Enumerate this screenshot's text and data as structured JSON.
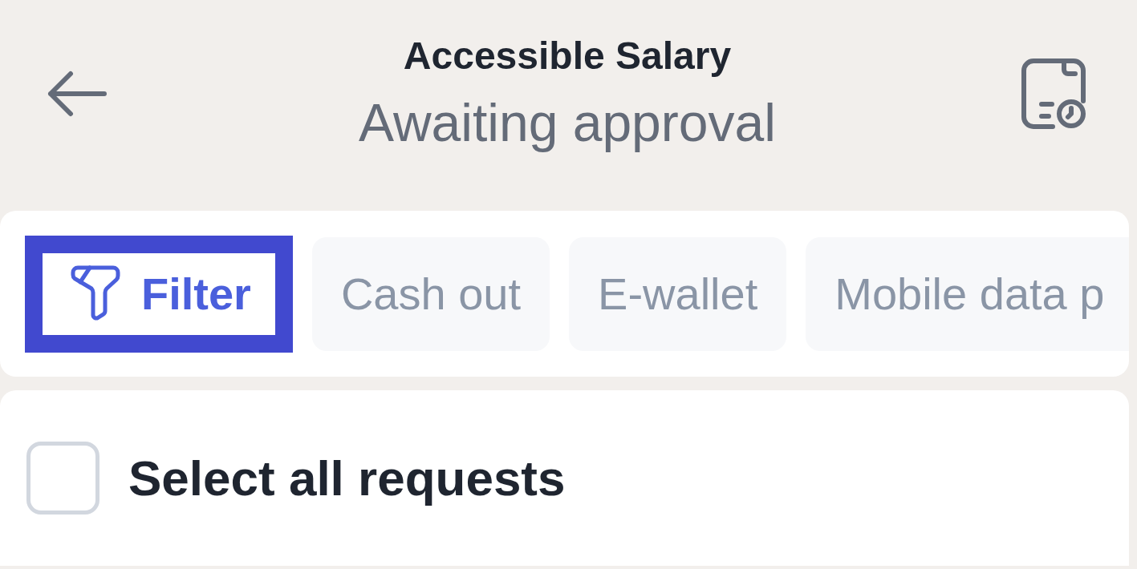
{
  "header": {
    "title": "Accessible Salary",
    "subtitle": "Awaiting approval"
  },
  "filters": {
    "chips": [
      {
        "kind": "filter",
        "label": "Filter",
        "focused": true
      },
      {
        "kind": "category",
        "label": "Cash out",
        "selected": false
      },
      {
        "kind": "category",
        "label": "E-wallet",
        "selected": false
      },
      {
        "kind": "category",
        "label": "Mobile data p",
        "selected": false
      }
    ]
  },
  "select_all": {
    "label": "Select all requests",
    "checked": false
  }
}
